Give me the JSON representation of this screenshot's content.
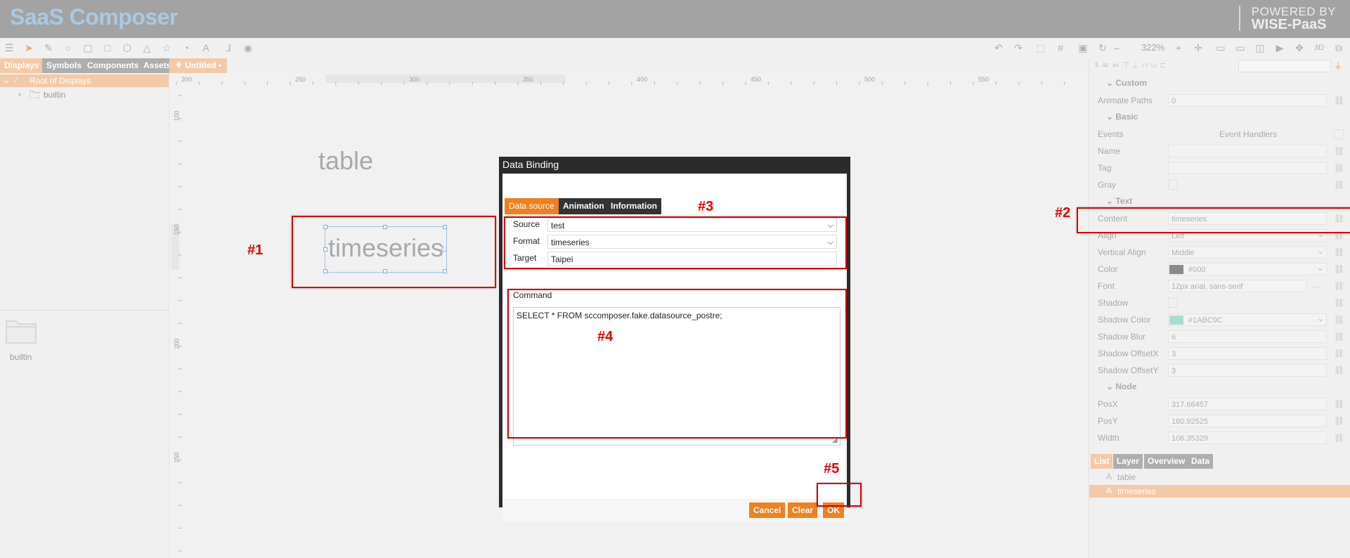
{
  "app": {
    "brand": "SaaS Composer",
    "powered_by_line1": "POWERED BY",
    "powered_by_line2": "WISE-PaaS"
  },
  "toolbar": {
    "zoom": "322%"
  },
  "left_panel": {
    "tabs": [
      "Displays",
      "Symbols",
      "Components",
      "Assets"
    ],
    "tree": {
      "root": "Root of Displays",
      "child": "builtin"
    },
    "folder_label": "builtin"
  },
  "doc_tab": {
    "label": "Untitled"
  },
  "canvas": {
    "ruler_x": [
      "200",
      "250",
      "300",
      "350",
      "400",
      "450",
      "500",
      "550"
    ],
    "ruler_y": [
      "100",
      "150",
      "200",
      "250"
    ],
    "label_table": "table",
    "label_ts": "timeseries"
  },
  "annotations": [
    "#1",
    "#2",
    "#3",
    "#4",
    "#5"
  ],
  "right_panel": {
    "sections": {
      "custom": "Custom",
      "basic": "Basic",
      "text": "Text",
      "node": "Node"
    },
    "animate_paths": {
      "label": "Animate Paths",
      "value": "0"
    },
    "events": {
      "label": "Events",
      "value": "Event Handlers"
    },
    "name": {
      "label": "Name",
      "value": ""
    },
    "tag": {
      "label": "Tag",
      "value": ""
    },
    "gray": {
      "label": "Gray"
    },
    "content": {
      "label": "Content",
      "value": "timeseries"
    },
    "align": {
      "label": "Align",
      "value": "Left"
    },
    "valign": {
      "label": "Vertical Align",
      "value": "Middle"
    },
    "color": {
      "label": "Color",
      "value": "#000",
      "swatch": "#8a8a8a"
    },
    "font": {
      "label": "Font",
      "value": "12px arial, sans-serif",
      "more": "..."
    },
    "shadow": {
      "label": "Shadow"
    },
    "shadow_color": {
      "label": "Shadow Color",
      "value": "#1ABC9C",
      "swatch": "#a8ddd2"
    },
    "shadow_blur": {
      "label": "Shadow Blur",
      "value": "6"
    },
    "shadow_offx": {
      "label": "Shadow OffsetX",
      "value": "3"
    },
    "shadow_offy": {
      "label": "Shadow OffsetY",
      "value": "3"
    },
    "posx": {
      "label": "PosX",
      "value": "317.66457"
    },
    "posy": {
      "label": "PosY",
      "value": "160.92525"
    },
    "width": {
      "label": "Width",
      "value": "106.35329"
    },
    "bottom_tabs": [
      "List",
      "Layer",
      "Overview",
      "Data"
    ],
    "list_items": [
      "table",
      "timeseries"
    ]
  },
  "dialog": {
    "title": "Data Binding",
    "tabs": [
      "Data source",
      "Animation",
      "Information"
    ],
    "source": {
      "label": "Source",
      "value": "test"
    },
    "format": {
      "label": "Format",
      "value": "timeseries"
    },
    "target": {
      "label": "Target",
      "value": "Taipei"
    },
    "command_label": "Command",
    "command": "SELECT * FROM sccomposer.fake.datasource_postre;",
    "buttons": {
      "cancel": "Cancel",
      "clear": "Clear",
      "ok": "OK"
    }
  },
  "colors": {
    "accent": "#f08020",
    "annotation": "#d40000",
    "header": "#a3a3a3"
  }
}
